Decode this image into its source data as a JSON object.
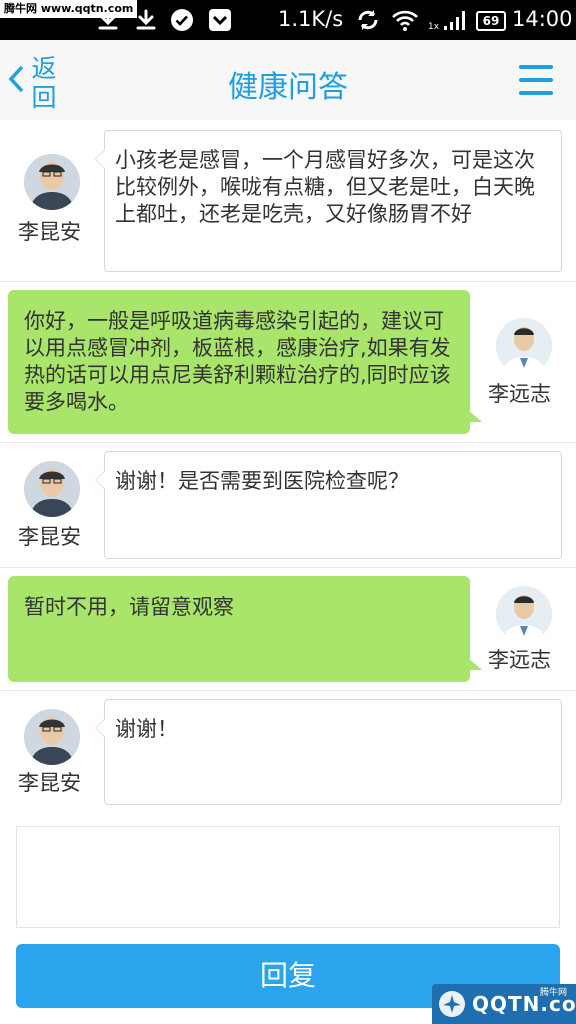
{
  "status_bar": {
    "watermark": "腾牛网 www.qqtn.com",
    "net_speed": "1.1K/s",
    "network_label": "1x",
    "battery": "69",
    "time": "14:00",
    "icons": [
      "download-icon",
      "download-icon",
      "check-circle-icon",
      "chevron-down-icon",
      "sync-icon",
      "wifi-icon",
      "signal-icon",
      "battery-icon"
    ]
  },
  "navbar": {
    "back_label": "返回",
    "title": "健康问答",
    "accent": "#1e9fe0"
  },
  "messages": [
    {
      "sender": "李昆安",
      "side": "left",
      "text": "小孩老是感冒，一个月感冒好多次，可是这次比较例外，喉咙有点糖，但又老是吐，白天晚上都吐，还老是吃壳，又好像肠胃不好"
    },
    {
      "sender": "李远志",
      "side": "right",
      "text": "你好，一般是呼吸道病毒感染引起的，建议可以用点感冒冲剂，板蓝根，感康治疗,如果有发热的话可以用点尼美舒利颗粒治疗的,同时应该要多喝水。"
    },
    {
      "sender": "李昆安",
      "side": "left",
      "text": "谢谢！是否需要到医院检查呢？"
    },
    {
      "sender": "李远志",
      "side": "right",
      "text": "暂时不用，请留意观察"
    },
    {
      "sender": "李昆安",
      "side": "left",
      "text": "谢谢！"
    }
  ],
  "reply": {
    "input_value": "",
    "button_label": "回复",
    "button_color": "#2aa4ec"
  },
  "corner_watermark": {
    "text": "QQTN.com",
    "small": "腾牛网"
  }
}
